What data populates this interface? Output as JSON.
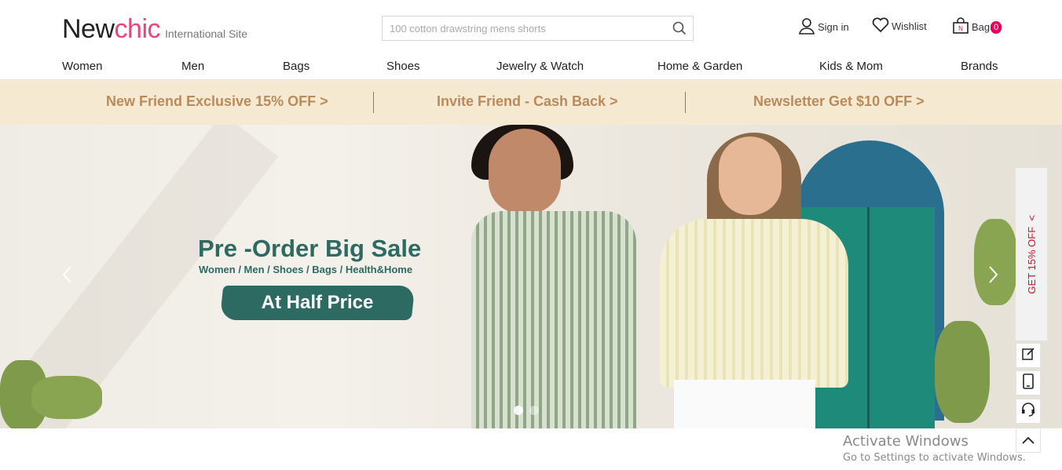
{
  "logo": {
    "part1": "New",
    "part2": "chic",
    "site": "International Site"
  },
  "search": {
    "placeholder": "100 cotton drawstring mens shorts",
    "icon": "search-icon"
  },
  "account": {
    "sign_in": "Sign in",
    "wishlist": "Wishlist",
    "bag": "Bag",
    "bag_count": "0"
  },
  "nav": [
    "Women",
    "Men",
    "Bags",
    "Shoes",
    "Jewelry & Watch",
    "Home & Garden",
    "Kids & Mom",
    "Brands"
  ],
  "promo": [
    "New Friend Exclusive 15% OFF >",
    "Invite Friend - Cash Back >",
    "Newsletter Get $10 OFF >"
  ],
  "hero": {
    "title": "Pre -Order Big Sale",
    "subtitle": "Women / Men / Shoes / Bags / Health&Home",
    "cta": "At Half Price",
    "slide_count": 2,
    "active_slide": 1
  },
  "side": {
    "discount_tab": "GET 15% OFF"
  },
  "watermark": {
    "title": "Activate Windows",
    "subtitle": "Go to Settings to activate Windows."
  },
  "colors": {
    "brand_pink": "#e8457a",
    "promo_text": "#b98a5c",
    "promo_bg": "#f6e9d2",
    "hero_green": "#2c6a62",
    "badge": "#e8005a",
    "discount_red": "#d0112b"
  }
}
